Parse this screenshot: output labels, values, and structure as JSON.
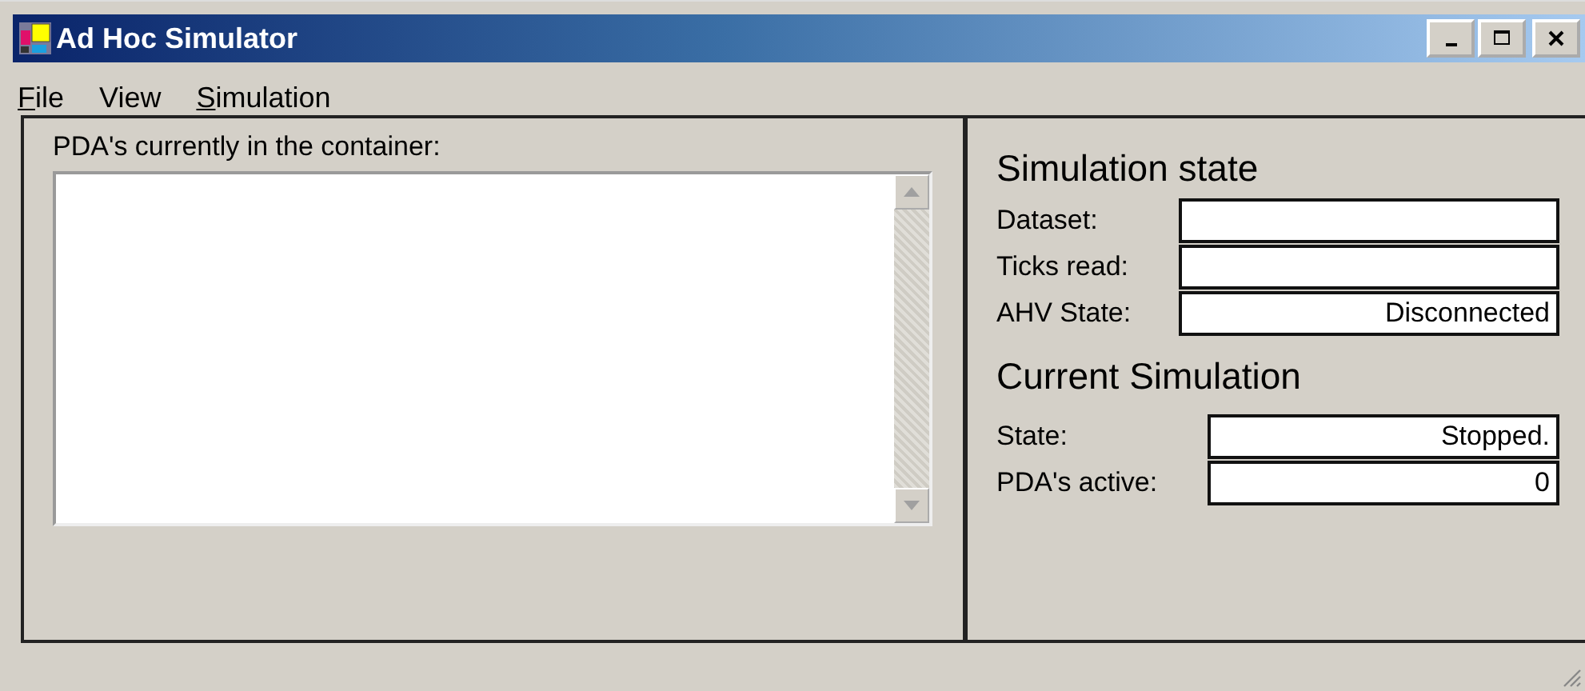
{
  "window": {
    "title": "Ad Hoc Simulator"
  },
  "menu": [
    {
      "label": "File",
      "mnemonic": true
    },
    {
      "label": "View",
      "mnemonic": false
    },
    {
      "label": "Simulation",
      "mnemonic": true
    }
  ],
  "left_panel": {
    "label": "PDA's currently in the container:"
  },
  "sections": [
    {
      "title": "Simulation state",
      "fields": [
        {
          "label": "Dataset:"
        },
        {
          "label": "Ticks read:"
        },
        {
          "label": "AHV State:",
          "value": "Disconnected"
        }
      ]
    },
    {
      "title": "Current Simulation",
      "fields": [
        {
          "label": "State:",
          "value": "Stopped."
        },
        {
          "label": "PDA's active:",
          "value": "0"
        }
      ]
    }
  ]
}
